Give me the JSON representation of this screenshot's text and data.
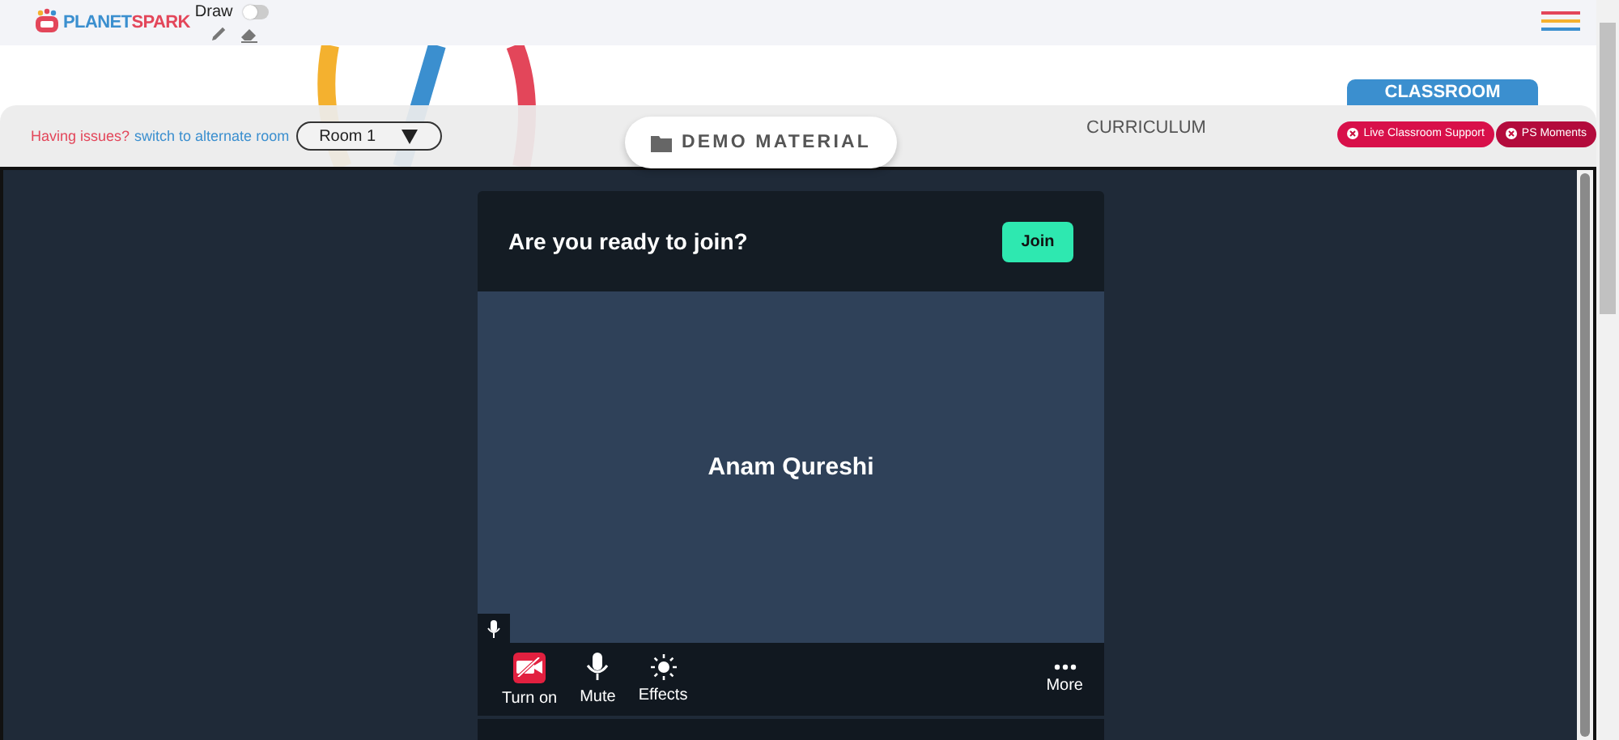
{
  "header": {
    "logo": {
      "text_a": "PLANET",
      "text_b": "SPARK"
    },
    "draw_toggle": {
      "label": "Draw",
      "on": false
    }
  },
  "room_bar": {
    "issue_text": "Having issues?",
    "switch_link": "switch to alternate room",
    "room_select": "Room 1",
    "demo_button": "DEMO MATERIAL",
    "curriculum_tab": "CURRICULUM",
    "classroom_tab": "CLASSROOM",
    "support_buttons": [
      "Live Classroom Support",
      "PS Moments"
    ]
  },
  "meeting": {
    "prompt": "Are you ready to join?",
    "join_button": "Join",
    "participant": "Anam Qureshi",
    "controls": [
      {
        "kind": "camera",
        "label": "Turn on",
        "on": false
      },
      {
        "kind": "mic",
        "label": "Mute",
        "on": true
      },
      {
        "kind": "effects",
        "label": "Effects"
      },
      {
        "kind": "more",
        "label": "More"
      }
    ]
  }
}
